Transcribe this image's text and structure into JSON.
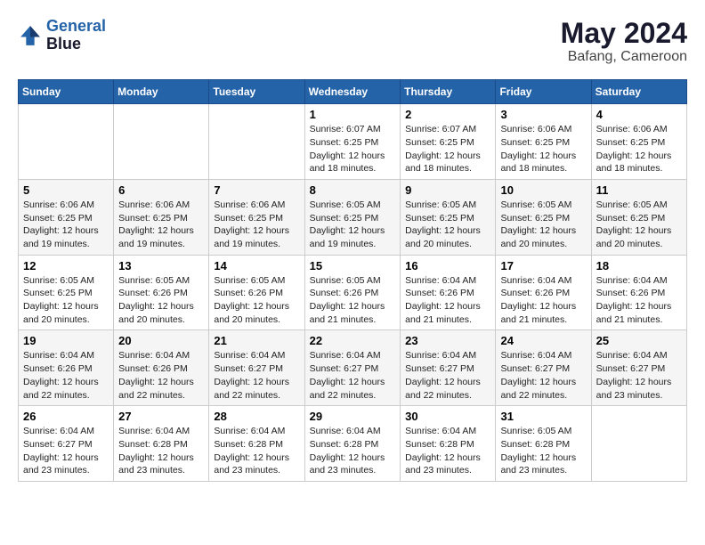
{
  "header": {
    "logo_line1": "General",
    "logo_line2": "Blue",
    "month_year": "May 2024",
    "location": "Bafang, Cameroon"
  },
  "weekdays": [
    "Sunday",
    "Monday",
    "Tuesday",
    "Wednesday",
    "Thursday",
    "Friday",
    "Saturday"
  ],
  "weeks": [
    [
      {
        "day": "",
        "info": ""
      },
      {
        "day": "",
        "info": ""
      },
      {
        "day": "",
        "info": ""
      },
      {
        "day": "1",
        "info": "Sunrise: 6:07 AM\nSunset: 6:25 PM\nDaylight: 12 hours\nand 18 minutes."
      },
      {
        "day": "2",
        "info": "Sunrise: 6:07 AM\nSunset: 6:25 PM\nDaylight: 12 hours\nand 18 minutes."
      },
      {
        "day": "3",
        "info": "Sunrise: 6:06 AM\nSunset: 6:25 PM\nDaylight: 12 hours\nand 18 minutes."
      },
      {
        "day": "4",
        "info": "Sunrise: 6:06 AM\nSunset: 6:25 PM\nDaylight: 12 hours\nand 18 minutes."
      }
    ],
    [
      {
        "day": "5",
        "info": "Sunrise: 6:06 AM\nSunset: 6:25 PM\nDaylight: 12 hours\nand 19 minutes."
      },
      {
        "day": "6",
        "info": "Sunrise: 6:06 AM\nSunset: 6:25 PM\nDaylight: 12 hours\nand 19 minutes."
      },
      {
        "day": "7",
        "info": "Sunrise: 6:06 AM\nSunset: 6:25 PM\nDaylight: 12 hours\nand 19 minutes."
      },
      {
        "day": "8",
        "info": "Sunrise: 6:05 AM\nSunset: 6:25 PM\nDaylight: 12 hours\nand 19 minutes."
      },
      {
        "day": "9",
        "info": "Sunrise: 6:05 AM\nSunset: 6:25 PM\nDaylight: 12 hours\nand 20 minutes."
      },
      {
        "day": "10",
        "info": "Sunrise: 6:05 AM\nSunset: 6:25 PM\nDaylight: 12 hours\nand 20 minutes."
      },
      {
        "day": "11",
        "info": "Sunrise: 6:05 AM\nSunset: 6:25 PM\nDaylight: 12 hours\nand 20 minutes."
      }
    ],
    [
      {
        "day": "12",
        "info": "Sunrise: 6:05 AM\nSunset: 6:25 PM\nDaylight: 12 hours\nand 20 minutes."
      },
      {
        "day": "13",
        "info": "Sunrise: 6:05 AM\nSunset: 6:26 PM\nDaylight: 12 hours\nand 20 minutes."
      },
      {
        "day": "14",
        "info": "Sunrise: 6:05 AM\nSunset: 6:26 PM\nDaylight: 12 hours\nand 20 minutes."
      },
      {
        "day": "15",
        "info": "Sunrise: 6:05 AM\nSunset: 6:26 PM\nDaylight: 12 hours\nand 21 minutes."
      },
      {
        "day": "16",
        "info": "Sunrise: 6:04 AM\nSunset: 6:26 PM\nDaylight: 12 hours\nand 21 minutes."
      },
      {
        "day": "17",
        "info": "Sunrise: 6:04 AM\nSunset: 6:26 PM\nDaylight: 12 hours\nand 21 minutes."
      },
      {
        "day": "18",
        "info": "Sunrise: 6:04 AM\nSunset: 6:26 PM\nDaylight: 12 hours\nand 21 minutes."
      }
    ],
    [
      {
        "day": "19",
        "info": "Sunrise: 6:04 AM\nSunset: 6:26 PM\nDaylight: 12 hours\nand 22 minutes."
      },
      {
        "day": "20",
        "info": "Sunrise: 6:04 AM\nSunset: 6:26 PM\nDaylight: 12 hours\nand 22 minutes."
      },
      {
        "day": "21",
        "info": "Sunrise: 6:04 AM\nSunset: 6:27 PM\nDaylight: 12 hours\nand 22 minutes."
      },
      {
        "day": "22",
        "info": "Sunrise: 6:04 AM\nSunset: 6:27 PM\nDaylight: 12 hours\nand 22 minutes."
      },
      {
        "day": "23",
        "info": "Sunrise: 6:04 AM\nSunset: 6:27 PM\nDaylight: 12 hours\nand 22 minutes."
      },
      {
        "day": "24",
        "info": "Sunrise: 6:04 AM\nSunset: 6:27 PM\nDaylight: 12 hours\nand 22 minutes."
      },
      {
        "day": "25",
        "info": "Sunrise: 6:04 AM\nSunset: 6:27 PM\nDaylight: 12 hours\nand 23 minutes."
      }
    ],
    [
      {
        "day": "26",
        "info": "Sunrise: 6:04 AM\nSunset: 6:27 PM\nDaylight: 12 hours\nand 23 minutes."
      },
      {
        "day": "27",
        "info": "Sunrise: 6:04 AM\nSunset: 6:28 PM\nDaylight: 12 hours\nand 23 minutes."
      },
      {
        "day": "28",
        "info": "Sunrise: 6:04 AM\nSunset: 6:28 PM\nDaylight: 12 hours\nand 23 minutes."
      },
      {
        "day": "29",
        "info": "Sunrise: 6:04 AM\nSunset: 6:28 PM\nDaylight: 12 hours\nand 23 minutes."
      },
      {
        "day": "30",
        "info": "Sunrise: 6:04 AM\nSunset: 6:28 PM\nDaylight: 12 hours\nand 23 minutes."
      },
      {
        "day": "31",
        "info": "Sunrise: 6:05 AM\nSunset: 6:28 PM\nDaylight: 12 hours\nand 23 minutes."
      },
      {
        "day": "",
        "info": ""
      }
    ]
  ]
}
